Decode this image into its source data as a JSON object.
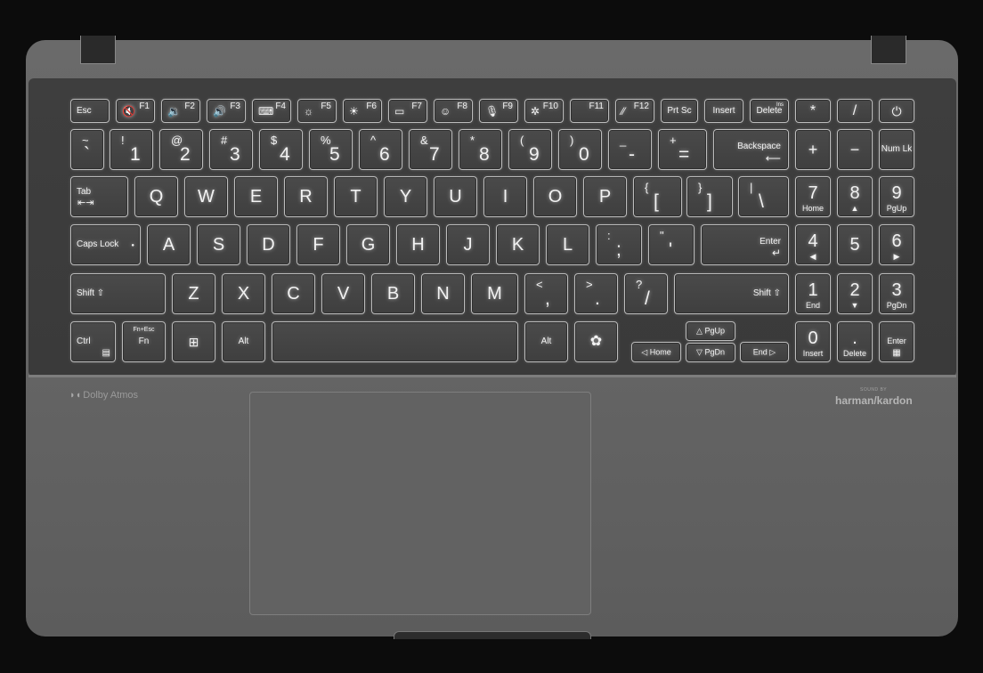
{
  "branding": {
    "dolby_text": "Dolby Atmos",
    "sound_by": "SOUND BY",
    "harman_kardon": "harman/kardon"
  },
  "keys": {
    "esc": "Esc",
    "f1": "F1",
    "f2": "F2",
    "f3": "F3",
    "f4": "F4",
    "f5": "F5",
    "f6": "F6",
    "f7": "F7",
    "f8": "F8",
    "f9": "F9",
    "f10": "F10",
    "f11": "F11",
    "f12": "F12",
    "prtsc": "Prt Sc",
    "insert": "Insert",
    "delete": "Delete",
    "ins": "Ins",
    "numpad_star": "*",
    "numpad_slash": "/",
    "tilde": "~",
    "backtick": "`",
    "excl": "!",
    "one": "1",
    "at": "@",
    "two": "2",
    "hash": "#",
    "three": "3",
    "dollar": "$",
    "four": "4",
    "percent": "%",
    "five": "5",
    "caret": "^",
    "six": "6",
    "amp": "&",
    "seven": "7",
    "asterisk": "*",
    "eight": "8",
    "lparen": "(",
    "nine": "9",
    "rparen": ")",
    "zero": "0",
    "underscore": "_",
    "minus": "-",
    "plus_sym": "+",
    "equals": "=",
    "backspace": "Backspace",
    "numpad_plus": "+",
    "numpad_minus": "−",
    "numlk": "Num Lk",
    "tab": "Tab",
    "q": "Q",
    "w": "W",
    "e": "E",
    "r": "R",
    "t": "T",
    "y": "Y",
    "u": "U",
    "i": "I",
    "o": "O",
    "p": "P",
    "lbrace": "{",
    "lbracket": "[",
    "rbrace": "}",
    "rbracket": "]",
    "pipe": "|",
    "backslash": "\\",
    "np7": "7",
    "np7_sub": "Home",
    "np8": "8",
    "np8_sub": "▲",
    "np9": "9",
    "np9_sub": "PgUp",
    "caps": "Caps Lock",
    "a": "A",
    "s": "S",
    "d": "D",
    "f": "F",
    "g": "G",
    "h": "H",
    "j": "J",
    "k": "K",
    "l": "L",
    "colon": ":",
    "semicolon": ";",
    "dquote": "\"",
    "squote": "'",
    "enter": "Enter",
    "np4": "4",
    "np4_sub": "◀",
    "np5": "5",
    "np6": "6",
    "np6_sub": "▶",
    "shift": "Shift ⇧",
    "z": "Z",
    "x": "X",
    "c": "C",
    "v": "V",
    "b": "B",
    "n": "N",
    "m": "M",
    "lt": "<",
    "comma": ",",
    "gt": ">",
    "period": ".",
    "question": "?",
    "slash": "/",
    "np1": "1",
    "np1_sub": "End",
    "np2": "2",
    "np2_sub": "▼",
    "np3": "3",
    "np3_sub": "PgDn",
    "ctrl": "Ctrl",
    "fn_top": "Fn+Esc",
    "fn": "Fn",
    "alt": "Alt",
    "pgup": "PgUp",
    "pgdn": "PgDn",
    "home": "Home",
    "end": "End",
    "np0": "0",
    "np0_sub": "Insert",
    "npdot": ".",
    "npdot_sub": "Delete",
    "np_enter": "Enter"
  },
  "icons": {
    "mute": "mute-icon",
    "vol_down": "volume-down-icon",
    "vol_up": "volume-up-icon",
    "kb_light": "keyboard-backlight-icon",
    "bright_down": "brightness-down-icon",
    "bright_up": "brightness-up-icon",
    "display": "display-switch-icon",
    "face": "face-icon",
    "mic": "mic-mute-icon",
    "fan": "fan-icon",
    "pen": "pen-icon",
    "power": "power-icon",
    "windows": "windows-icon",
    "copilot": "copilot-icon",
    "menu": "menu-icon",
    "lock": "lock-icon",
    "calc": "calculator-icon"
  }
}
